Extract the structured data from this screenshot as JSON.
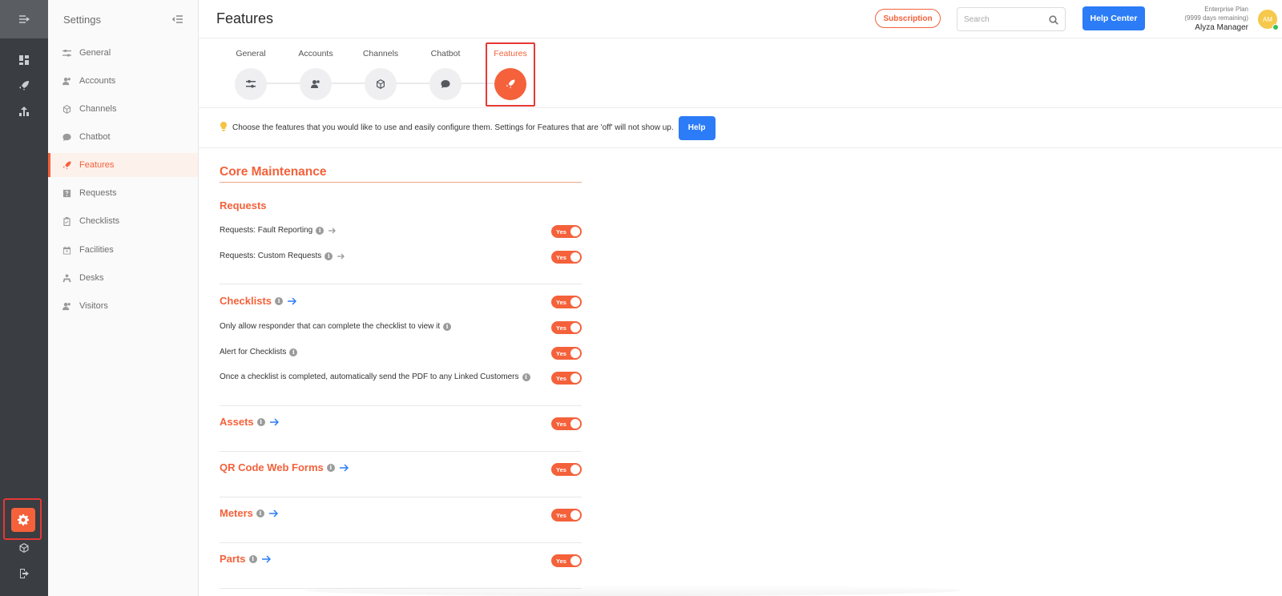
{
  "app": {
    "page_title": "Features"
  },
  "sidebar": {
    "title": "Settings",
    "items": [
      {
        "label": "General",
        "icon": "sliders-icon"
      },
      {
        "label": "Accounts",
        "icon": "users-icon"
      },
      {
        "label": "Channels",
        "icon": "cube-icon"
      },
      {
        "label": "Chatbot",
        "icon": "chat-icon"
      },
      {
        "label": "Features",
        "icon": "rocket-icon",
        "active": true
      },
      {
        "label": "Requests",
        "icon": "question-icon"
      },
      {
        "label": "Checklists",
        "icon": "clipboard-icon"
      },
      {
        "label": "Facilities",
        "icon": "calendar-icon"
      },
      {
        "label": "Desks",
        "icon": "desk-icon"
      },
      {
        "label": "Visitors",
        "icon": "visitors-icon"
      }
    ]
  },
  "header": {
    "subscription_label": "Subscription",
    "search_placeholder": "Search",
    "help_center_label": "Help Center",
    "plan_name": "Enterprise Plan",
    "plan_days": "(9999 days remaining)",
    "user_name": "Alyza Manager",
    "avatar_initials": "AM"
  },
  "stepper": {
    "steps": [
      {
        "label": "General",
        "icon": "sliders-icon"
      },
      {
        "label": "Accounts",
        "icon": "users-icon"
      },
      {
        "label": "Channels",
        "icon": "cube-icon"
      },
      {
        "label": "Chatbot",
        "icon": "chat-icon"
      },
      {
        "label": "Features",
        "icon": "rocket-icon",
        "active": true
      }
    ]
  },
  "info": {
    "text": "Choose the features that you would like to use and easily configure them. Settings for Features that are 'off' will not show up.",
    "help_label": "Help"
  },
  "content": {
    "section_title": "Core Maintenance",
    "toggle_label": "Yes",
    "requests": {
      "title": "Requests",
      "rows": [
        {
          "label": "Requests: Fault Reporting"
        },
        {
          "label": "Requests: Custom Requests"
        }
      ]
    },
    "checklists": {
      "title": "Checklists",
      "rows": [
        {
          "label": "Only allow responder that can complete the checklist to view it"
        },
        {
          "label": "Alert for Checklists"
        },
        {
          "label": "Once a checklist is completed, automatically send the PDF to any Linked Customers"
        }
      ]
    },
    "groups": [
      {
        "title": "Assets"
      },
      {
        "title": "QR Code Web Forms"
      },
      {
        "title": "Meters"
      },
      {
        "title": "Parts"
      }
    ]
  },
  "colors": {
    "accent": "#f4613a",
    "primary_blue": "#2b7cf6",
    "rail_bg": "#3a3d42",
    "highlight_frame": "#e53935"
  }
}
